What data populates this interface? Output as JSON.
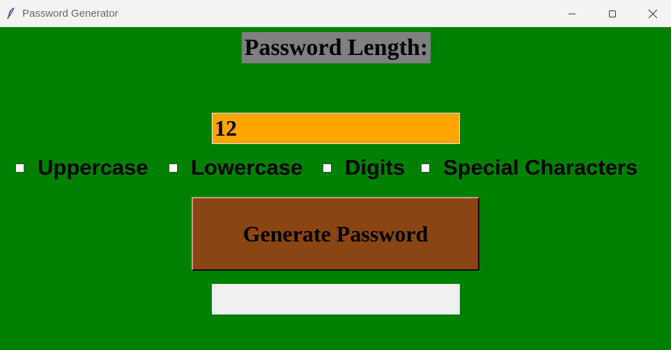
{
  "window": {
    "title": "Password Generator",
    "icon": "feather-icon",
    "controls": [
      "minimize-icon",
      "maximize-icon",
      "close-icon"
    ]
  },
  "form": {
    "length_label": "Password Length:",
    "length_value": "12",
    "options": [
      {
        "label": "Uppercase",
        "checked": false
      },
      {
        "label": "Lowercase",
        "checked": false
      },
      {
        "label": "Digits",
        "checked": false
      },
      {
        "label": "Special Characters",
        "checked": false
      }
    ],
    "generate_label": "Generate Password",
    "output_value": ""
  },
  "colors": {
    "background": "#008000",
    "label_bg": "#808080",
    "input_bg": "#ffa500",
    "button_bg": "#8b4513",
    "output_bg": "#f0f0f0"
  }
}
